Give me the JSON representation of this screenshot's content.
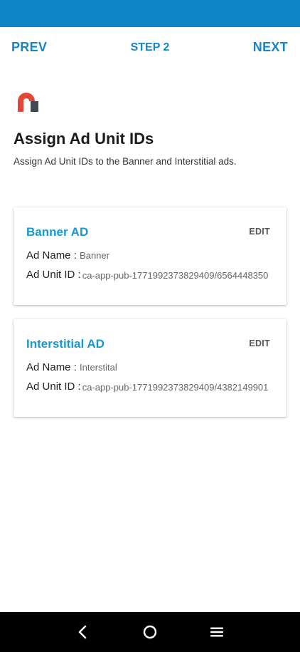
{
  "stepper": {
    "prev_label": "PREV",
    "step_label": "STEP 2",
    "next_label": "NEXT"
  },
  "header": {
    "title": "Assign Ad Unit IDs",
    "subtitle": "Assign Ad Unit IDs to the Banner and Interstitial ads."
  },
  "cards": [
    {
      "title": "Banner AD",
      "edit_label": "EDIT",
      "ad_name_label": "Ad Name :",
      "ad_name_value": "Banner",
      "ad_unit_id_label": "Ad Unit ID :",
      "ad_unit_id_value": "ca-app-pub-1771992373829409/6564448350"
    },
    {
      "title": "Interstitial AD",
      "edit_label": "EDIT",
      "ad_name_label": "Ad Name :",
      "ad_name_value": "Interstital",
      "ad_unit_id_label": "Ad Unit ID :",
      "ad_unit_id_value": "ca-app-pub-1771992373829409/4382149901"
    }
  ],
  "colors": {
    "status_bar": "#0f84c7",
    "accent": "#1486c6",
    "card_title": "#1699cf",
    "logo_red": "#e2473a",
    "logo_gray": "#3f4a52"
  },
  "icons": {
    "app_logo": "app-logo-icon",
    "back": "back-icon",
    "home": "home-icon",
    "menu": "menu-icon"
  }
}
